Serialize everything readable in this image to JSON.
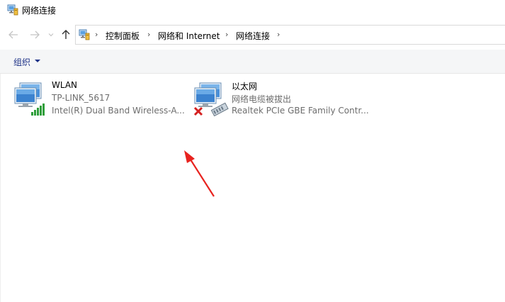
{
  "window": {
    "title": "网络连接"
  },
  "nav": {
    "back_icon": "arrow-left-icon",
    "forward_icon": "arrow-right-icon",
    "recent_icon": "chevron-down-icon",
    "up_icon": "arrow-up-icon"
  },
  "address": {
    "breadcrumbs": [
      "控制面板",
      "网络和 Internet",
      "网络连接"
    ]
  },
  "toolbar": {
    "organize_label": "组织"
  },
  "adapters": [
    {
      "name": "WLAN",
      "network": "TP-LINK_5617",
      "device": "Intel(R) Dual Band Wireless-A...",
      "status": "connected"
    },
    {
      "name": "以太网",
      "network": "网络电缆被拔出",
      "device": "Realtek PCIe GBE Family Contr...",
      "status": "disconnected"
    }
  ],
  "annotation": {
    "color": "#e8231f"
  }
}
